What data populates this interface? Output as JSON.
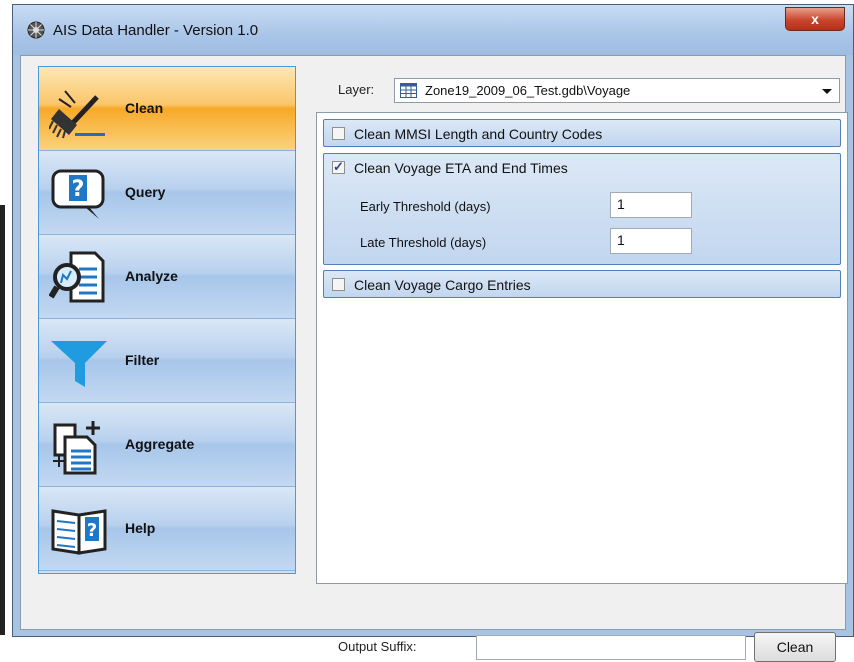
{
  "window": {
    "title": "AIS Data Handler - Version 1.0",
    "close_symbol": "x"
  },
  "nav": {
    "items": [
      {
        "label": "Clean",
        "icon": "broom-icon",
        "active": true
      },
      {
        "label": "Query",
        "icon": "question-bubble-icon",
        "active": false
      },
      {
        "label": "Analyze",
        "icon": "magnify-document-icon",
        "active": false
      },
      {
        "label": "Filter",
        "icon": "funnel-icon",
        "active": false
      },
      {
        "label": "Aggregate",
        "icon": "documents-plus-icon",
        "active": false
      },
      {
        "label": "Help",
        "icon": "help-book-icon",
        "active": false
      }
    ]
  },
  "layer": {
    "label": "Layer:",
    "value": "Zone19_2009_06_Test.gdb\\Voyage"
  },
  "options": {
    "groups": [
      {
        "title": "Clean MMSI Length and Country Codes",
        "checked": false
      },
      {
        "title": "Clean Voyage ETA and End Times",
        "checked": true,
        "fields": [
          {
            "label": "Early Threshold (days)",
            "value": "1"
          },
          {
            "label": "Late Threshold (days)",
            "value": "1"
          }
        ]
      },
      {
        "title": "Clean Voyage Cargo Entries",
        "checked": false
      }
    ]
  },
  "footer": {
    "suffix_label": "Output Suffix:",
    "suffix_value": "",
    "clean_button": "Clean"
  },
  "colors": {
    "active_nav": "#f7a928",
    "nav": "#b9d1ee",
    "group": "#c1d6ef",
    "title_bar": "#a9c5e8"
  }
}
